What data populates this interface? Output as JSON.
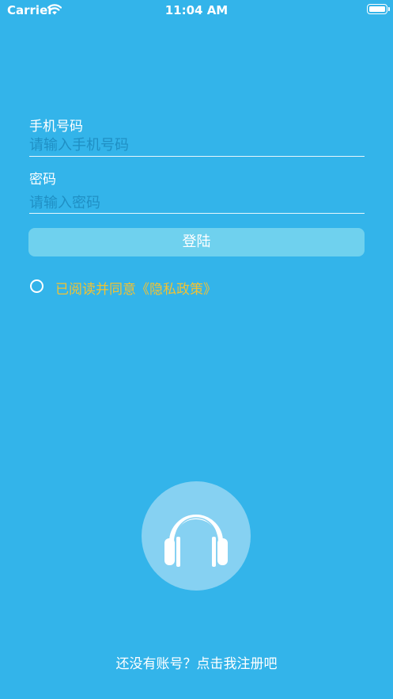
{
  "status_bar": {
    "carrier": "Carrier",
    "time": "11:04 AM"
  },
  "phone": {
    "label": "手机号码",
    "placeholder": "请输入手机号码",
    "value": ""
  },
  "password": {
    "label": "密码",
    "placeholder": "请输入密码",
    "value": ""
  },
  "login_button": "登陆",
  "agreement": {
    "checked": false,
    "text": "已阅读并同意《隐私政策》"
  },
  "register_link": "还没有账号？点击我注册吧",
  "icons": {
    "signal": "wifi-icon",
    "battery": "battery-icon",
    "logo": "headphones-icon"
  },
  "colors": {
    "background": "#33B4EA",
    "button": "#6FD1EE",
    "agreement_text": "#F2C232",
    "logo_circle": "#86D1F2"
  }
}
